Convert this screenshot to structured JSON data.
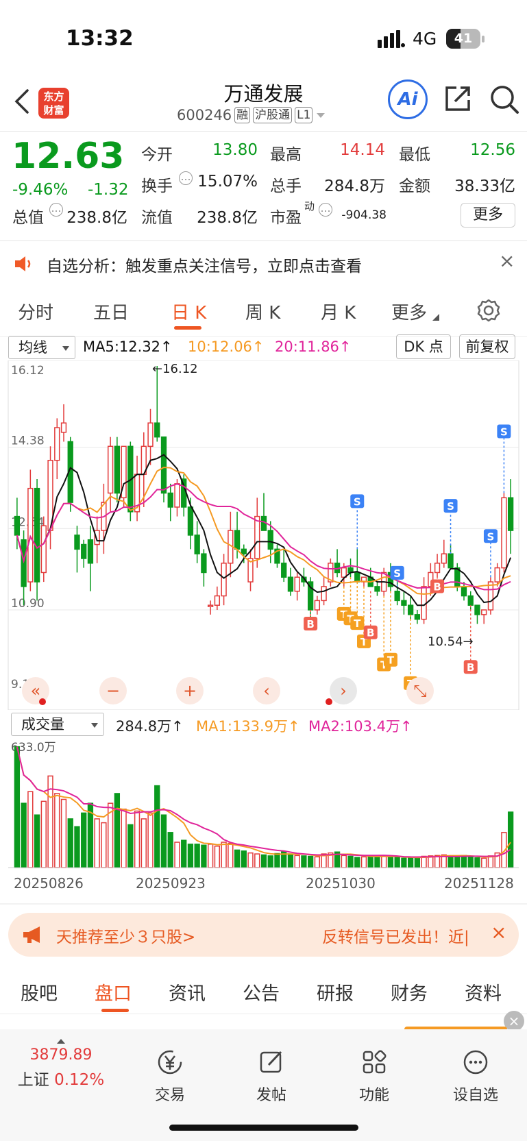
{
  "status": {
    "time": "13:32",
    "network": "4G",
    "battery": "41",
    "battery_level": 0.41
  },
  "header": {
    "stock_name": "万通发展",
    "code": "600246",
    "tags": [
      "融",
      "沪股通",
      "L1"
    ],
    "logo_line1": "东方",
    "logo_line2": "财富",
    "ai_label": "Ai"
  },
  "quote": {
    "price": "12.63",
    "change_pct": "-9.46%",
    "change": "-1.32",
    "open_label": "今开",
    "open": "13.80",
    "high_label": "最高",
    "high": "14.14",
    "low_label": "最低",
    "low": "12.56",
    "turnover_label": "换手",
    "turnover": "15.07%",
    "volume_label": "总手",
    "volume": "284.8万",
    "amount_label": "金额",
    "amount": "38.33亿",
    "mktcap_label": "总值",
    "mktcap": "238.8亿",
    "float_label": "流值",
    "float": "238.8亿",
    "pe_label": "市盈",
    "pe_sup": "动",
    "pe": "-904.38",
    "more": "更多"
  },
  "notice": {
    "text": "自选分析：触发重点关注信号，立即点击查看",
    "close": "×"
  },
  "tabs": {
    "items": [
      "分时",
      "五日",
      "日 K",
      "周 K",
      "月 K",
      "更多"
    ],
    "active": 2
  },
  "chart": {
    "ma_select": "均线",
    "ma5": "MA5:12.32↑",
    "ma10": "10:12.06↑",
    "ma20": "20:11.86↑",
    "dk_button": "DK 点",
    "adjust_button": "前复权",
    "y_labels": [
      "16.12",
      "14.38",
      "12.64",
      "10.90",
      "9.17"
    ],
    "high_annot": "←16.12",
    "low_annot": "10.54→",
    "vol_select": "成交量",
    "vol_value": "284.8万↑",
    "vol_ma1": "MA1:133.9万↑",
    "vol_ma2": "MA2:103.4万↑",
    "vol_max": "633.0万",
    "dates": [
      "20250826",
      "20250923",
      "20251030",
      "20251128"
    ],
    "signal_labels": {
      "buy": "B",
      "sell": "S",
      "t": "T"
    },
    "colors": {
      "up": "#e23b3b",
      "down": "#0a9a1e",
      "ma5": "#111111",
      "ma10": "#f59a23",
      "ma20": "#e0249a"
    }
  },
  "chart_data": {
    "type": "candlestick",
    "ylim": [
      9.17,
      16.12
    ],
    "candles": [
      [
        12.9,
        13.3,
        12.2,
        12.5
      ],
      [
        12.4,
        12.6,
        11.0,
        11.4
      ],
      [
        11.5,
        13.9,
        11.3,
        13.5
      ],
      [
        13.5,
        13.7,
        11.1,
        11.5
      ],
      [
        11.7,
        12.9,
        11.5,
        12.7
      ],
      [
        12.6,
        14.4,
        12.2,
        14.1
      ],
      [
        14.1,
        15.0,
        13.7,
        14.8
      ],
      [
        14.7,
        15.3,
        14.5,
        14.9
      ],
      [
        14.5,
        14.6,
        13.0,
        13.2
      ],
      [
        12.5,
        12.7,
        11.7,
        12.2
      ],
      [
        12.3,
        12.4,
        11.8,
        12.0
      ],
      [
        12.4,
        12.7,
        11.3,
        11.9
      ],
      [
        12.3,
        12.9,
        11.9,
        12.6
      ],
      [
        12.6,
        13.6,
        12.1,
        13.2
      ],
      [
        13.4,
        14.6,
        13.0,
        14.4
      ],
      [
        14.4,
        14.6,
        13.2,
        13.4
      ],
      [
        13.3,
        14.4,
        13.1,
        14.4
      ],
      [
        14.4,
        14.5,
        12.8,
        13.0
      ],
      [
        13.0,
        14.2,
        12.8,
        13.8
      ],
      [
        13.8,
        14.7,
        13.1,
        14.4
      ],
      [
        14.4,
        15.2,
        14.0,
        14.9
      ],
      [
        14.9,
        16.12,
        14.5,
        14.6
      ],
      [
        14.6,
        14.6,
        13.2,
        13.4
      ],
      [
        13.4,
        13.6,
        12.8,
        13.1
      ],
      [
        13.1,
        13.7,
        12.9,
        13.6
      ],
      [
        13.7,
        13.8,
        12.9,
        13.1
      ],
      [
        13.1,
        13.3,
        12.2,
        12.5
      ],
      [
        12.5,
        12.8,
        11.9,
        12.1
      ],
      [
        12.1,
        12.2,
        11.4,
        11.7
      ],
      [
        11.0,
        11.1,
        10.8,
        11.0
      ],
      [
        11.0,
        11.4,
        10.9,
        11.2
      ],
      [
        11.2,
        12.1,
        11.0,
        11.9
      ],
      [
        11.9,
        13.0,
        11.6,
        12.6
      ],
      [
        12.6,
        13.0,
        12.0,
        12.2
      ],
      [
        12.2,
        12.3,
        11.9,
        12.1
      ],
      [
        11.5,
        12.2,
        11.3,
        12.0
      ],
      [
        12.0,
        13.3,
        11.8,
        12.9
      ],
      [
        12.9,
        13.4,
        12.7,
        12.6
      ],
      [
        12.6,
        12.8,
        11.9,
        12.2
      ],
      [
        12.2,
        12.3,
        11.8,
        11.9
      ],
      [
        11.9,
        12.2,
        11.5,
        11.6
      ],
      [
        11.6,
        11.8,
        11.2,
        11.3
      ],
      [
        11.3,
        11.7,
        11.1,
        11.6
      ],
      [
        11.6,
        11.8,
        11.4,
        11.5
      ],
      [
        11.5,
        11.6,
        10.6,
        10.9
      ],
      [
        10.9,
        11.2,
        10.8,
        11.1
      ],
      [
        11.1,
        11.6,
        11.0,
        11.4
      ],
      [
        11.5,
        12.0,
        11.4,
        11.9
      ],
      [
        11.9,
        12.2,
        11.6,
        11.7
      ],
      [
        11.6,
        11.9,
        11.4,
        11.8
      ],
      [
        11.8,
        12.0,
        11.6,
        11.7
      ],
      [
        11.7,
        12.2,
        11.6,
        11.5
      ],
      [
        11.5,
        11.6,
        11.4,
        11.6
      ],
      [
        11.6,
        11.8,
        11.4,
        11.4
      ],
      [
        11.4,
        11.5,
        11.2,
        11.3
      ],
      [
        11.3,
        11.8,
        11.2,
        11.7
      ],
      [
        11.7,
        11.9,
        11.3,
        11.4
      ],
      [
        11.3,
        11.5,
        11.0,
        11.1
      ],
      [
        11.1,
        11.3,
        10.8,
        11.0
      ],
      [
        11.0,
        11.2,
        10.7,
        10.8
      ],
      [
        10.8,
        10.9,
        10.6,
        10.7
      ],
      [
        10.7,
        11.6,
        10.6,
        11.4
      ],
      [
        11.4,
        11.9,
        11.2,
        11.7
      ],
      [
        11.7,
        12.1,
        11.6,
        11.9
      ],
      [
        11.9,
        12.4,
        11.8,
        12.1
      ],
      [
        12.1,
        12.3,
        11.8,
        11.8
      ],
      [
        11.8,
        11.9,
        11.3,
        11.4
      ],
      [
        11.4,
        11.5,
        11.1,
        11.2
      ],
      [
        11.2,
        11.3,
        10.9,
        11.0
      ],
      [
        11.0,
        11.0,
        10.6,
        10.8
      ],
      [
        10.8,
        10.9,
        10.6,
        10.9
      ],
      [
        10.9,
        11.6,
        10.8,
        11.5
      ],
      [
        11.5,
        11.9,
        11.4,
        11.8
      ],
      [
        11.8,
        13.4,
        11.7,
        13.3
      ],
      [
        13.3,
        13.7,
        12.1,
        12.6
      ]
    ],
    "volumes": [
      620,
      330,
      390,
      270,
      340,
      470,
      380,
      350,
      250,
      210,
      280,
      330,
      250,
      230,
      330,
      380,
      300,
      220,
      290,
      250,
      280,
      420,
      270,
      180,
      130,
      140,
      120,
      120,
      115,
      120,
      110,
      130,
      125,
      90,
      85,
      75,
      70,
      65,
      60,
      72,
      80,
      70,
      62,
      60,
      58,
      55,
      70,
      75,
      80,
      62,
      58,
      52,
      55,
      60,
      58,
      60,
      55,
      52,
      48,
      50,
      55,
      58,
      60,
      62,
      65,
      60,
      58,
      62,
      55,
      50,
      48,
      60,
      75,
      180,
      284.8
    ],
    "vol_ylim": [
      0,
      633
    ]
  }
}
